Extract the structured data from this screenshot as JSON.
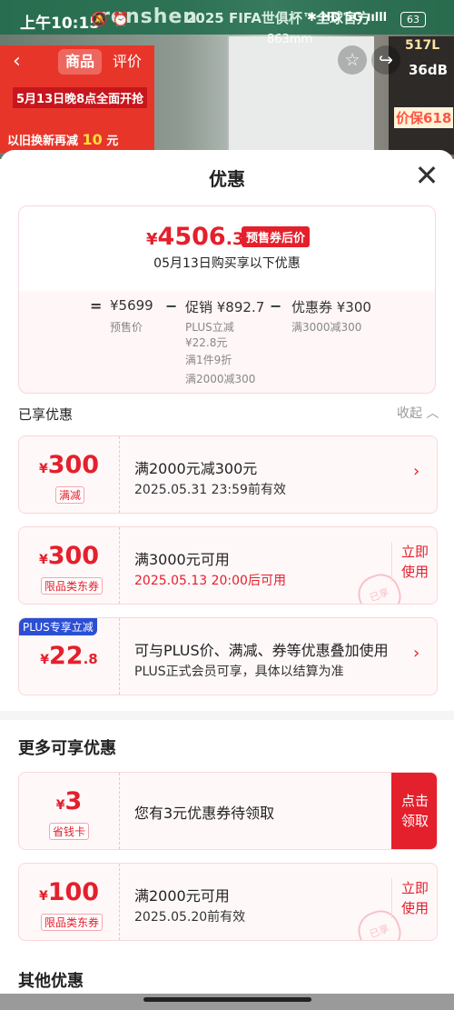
{
  "status_bar": {
    "time": "上午10:15",
    "notif_icons": "🔕 ⏰",
    "right_icons": "✱ HD 5G ıılll",
    "battery": "63"
  },
  "backdrop": {
    "brand": "ronshen",
    "fifa_text": "2025 FIFA世俱杯™全球官方",
    "promo_date": "5月13日晚8点全面开抢",
    "promo_trade": "以旧换新再减",
    "promo_trade_amount": "10",
    "promo_trade_unit": "元",
    "dimension": "863mm",
    "right_1": "517L",
    "right_2": "36dB",
    "right_3": "价保618"
  },
  "nav": {
    "tab_goods": "商品",
    "tab_reviews": "评价",
    "back_icon": "‹",
    "star_icon": "☆",
    "share_icon": "↪"
  },
  "sheet": {
    "title": "优惠",
    "close_icon": "✕",
    "summary": {
      "currency": "¥",
      "price_int": "4506",
      "price_dec": ".3",
      "badge": "预售券后价",
      "subtitle": "05月13日购买享以下优惠",
      "eq": "=",
      "presale_value": "¥5699",
      "presale_label": "预售价",
      "minus1": "−",
      "promo_value": "促销 ¥892.7",
      "promo_plus": "PLUS立减",
      "promo_plus_amount": "¥22.8元",
      "promo_discount": "满1件9折",
      "promo_full": "满2000减300",
      "minus2": "−",
      "coupon_value": "优惠券 ¥300",
      "coupon_label": "满3000减300"
    },
    "enjoyed_label": "已享优惠",
    "collapse_label": "收起 ︿",
    "coupons": [
      {
        "currency": "¥",
        "amount": "300",
        "dec": "",
        "tag": "满减",
        "title": "满2000元减300元",
        "date": "2025.05.31 23:59前有效",
        "arrow": "›"
      },
      {
        "currency": "¥",
        "amount": "300",
        "dec": "",
        "tag": "限品类东券",
        "title": "满3000元可用",
        "date": "2025.05.13 20:00后可用",
        "action_1": "立即",
        "action_2": "使用",
        "stamp": "已享"
      },
      {
        "currency": "¥",
        "amount": "22",
        "dec": ".8",
        "plus_badge": "PLUS专享立减",
        "title": "可与PLUS价、满减、券等优惠叠加使用",
        "date": "PLUS正式会员可享，具体以结算为准",
        "arrow": "›"
      }
    ],
    "more_title": "更多可享优惠",
    "more_coupons": [
      {
        "currency": "¥",
        "amount": "3",
        "tag": "省钱卡",
        "title": "您有3元优惠券待领取",
        "action_1": "点击",
        "action_2": "领取"
      },
      {
        "currency": "¥",
        "amount": "100",
        "tag": "限品类东券",
        "title": "满2000元可用",
        "date": "2025.05.20前有效",
        "action_1": "立即",
        "action_2": "使用",
        "stamp": "已享"
      }
    ],
    "other_title": "其他优惠"
  }
}
